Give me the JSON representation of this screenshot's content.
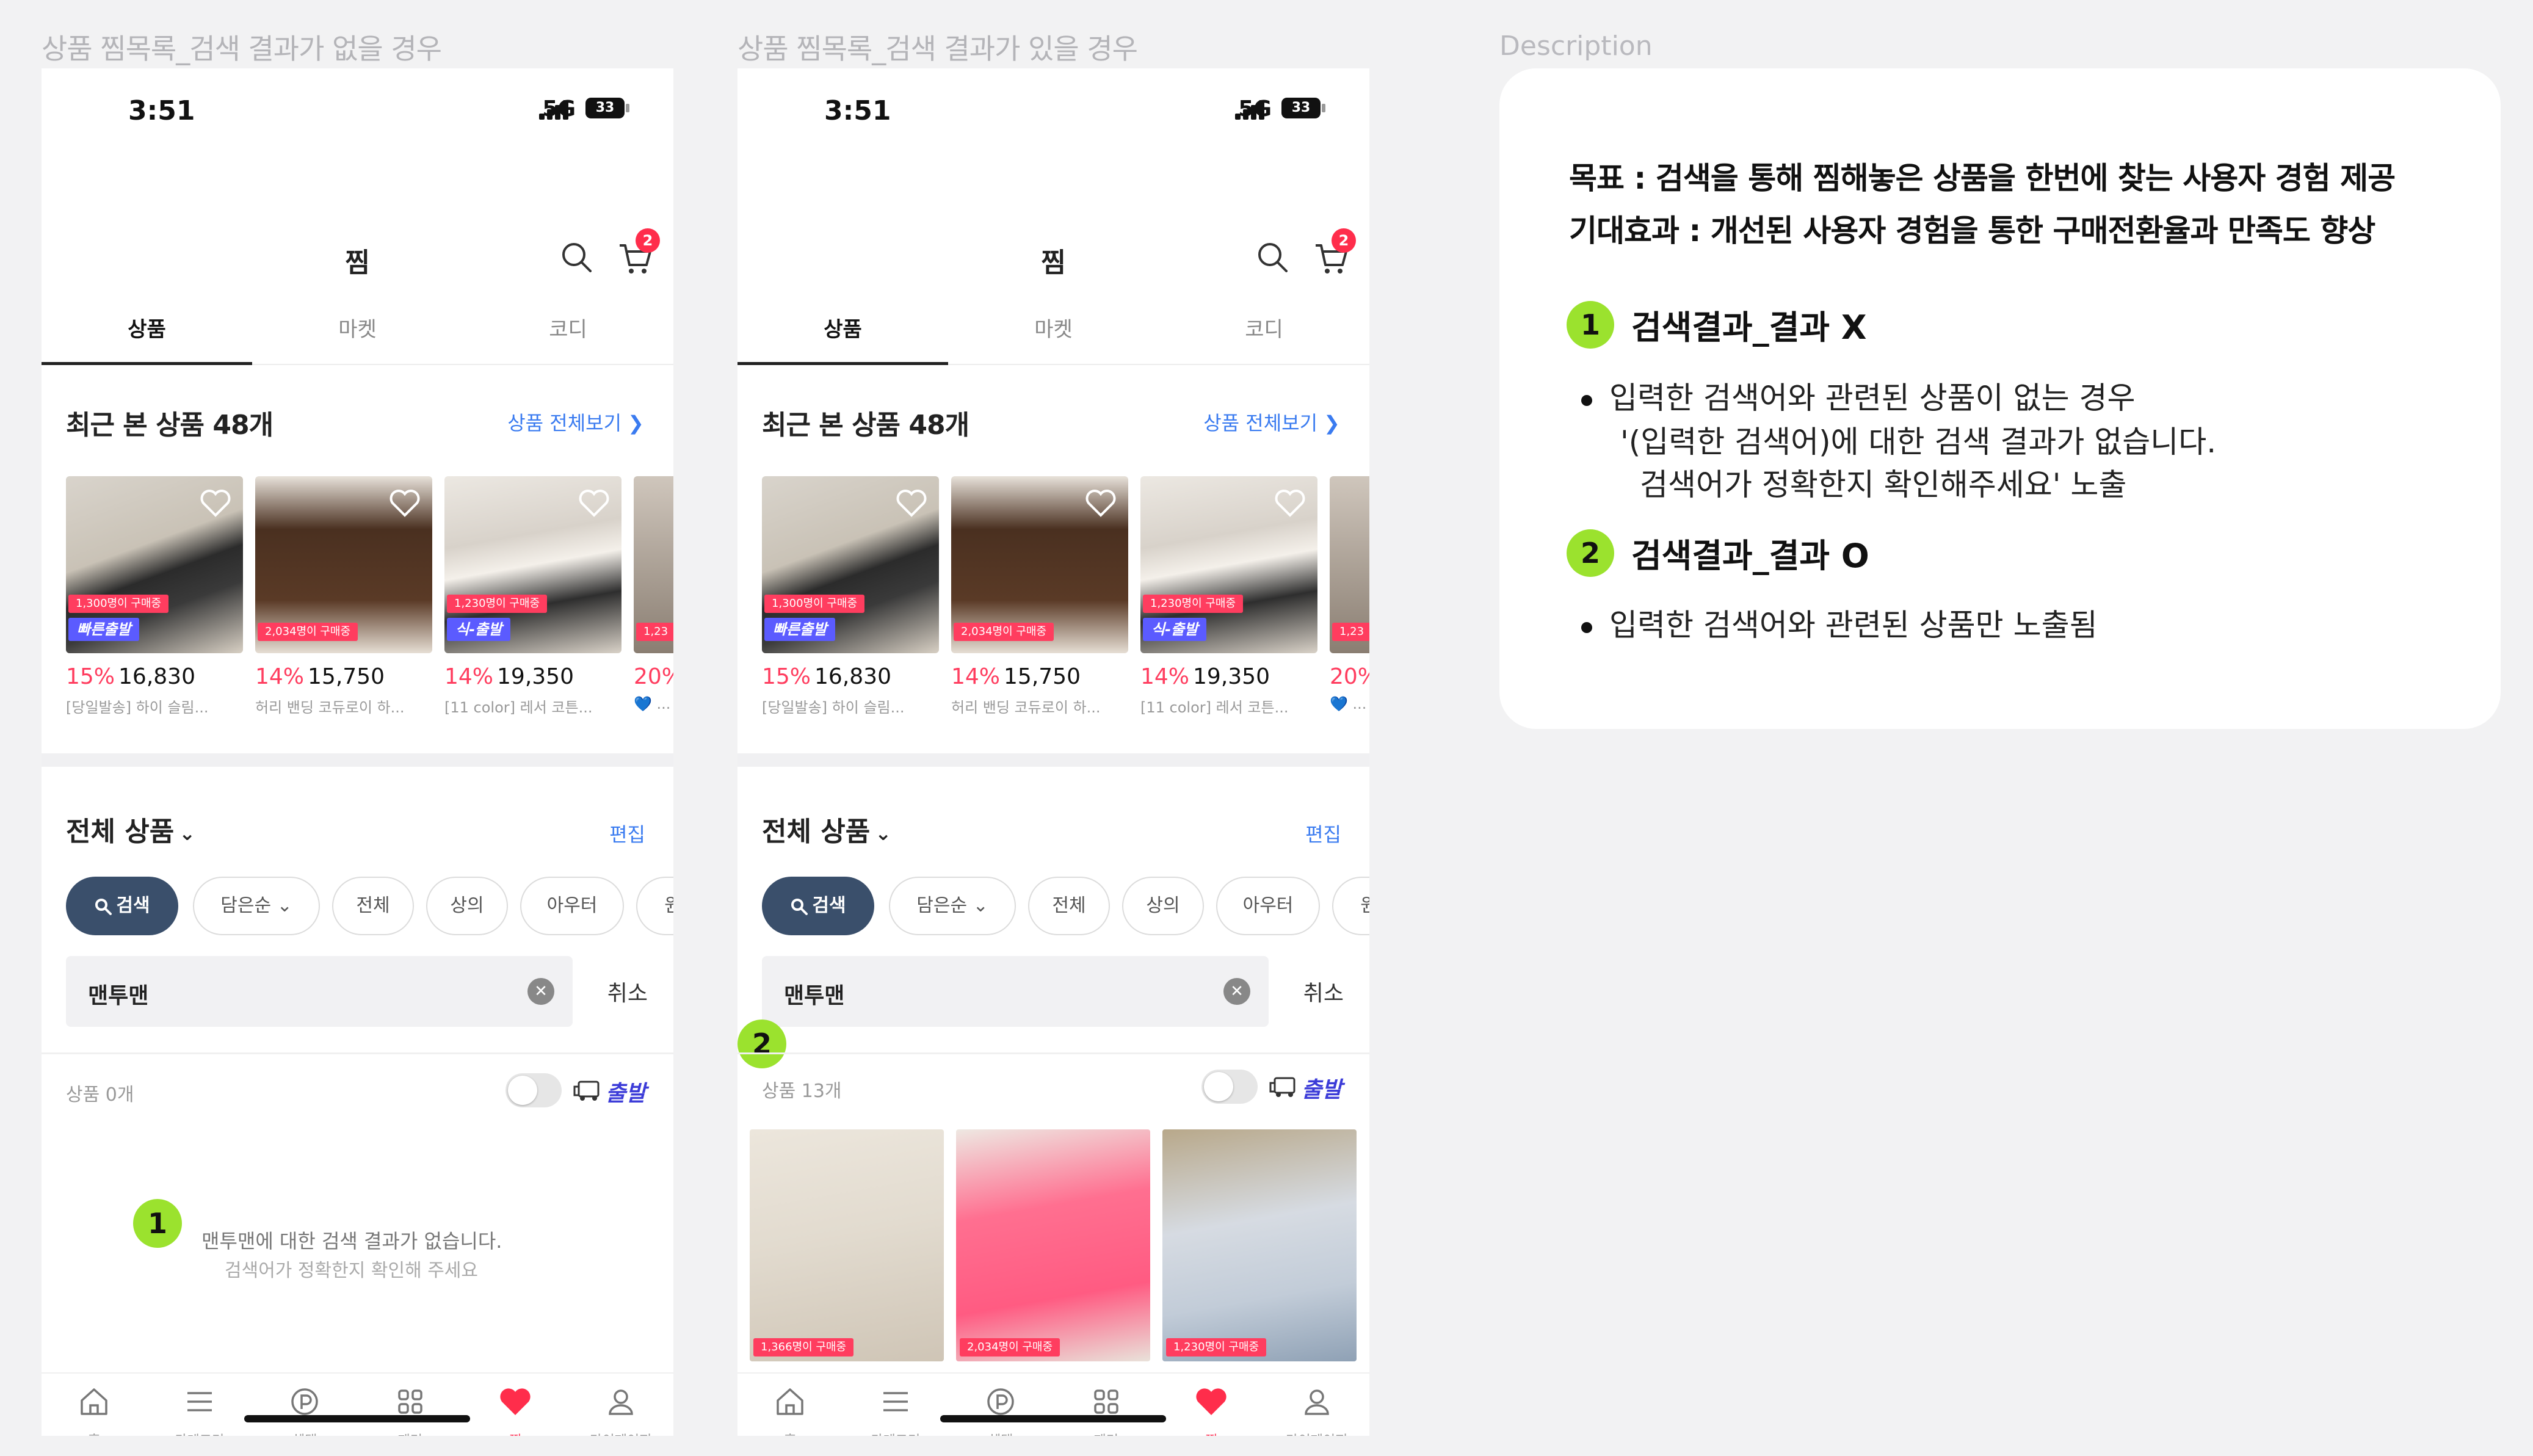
{
  "captions": {
    "left": "상품 찜목록_검색 결과가 없을 경우",
    "middle": "상품 찜목록_검색 결과가 있을 경우",
    "description": "Description"
  },
  "status": {
    "time": "3:51",
    "network": "5G",
    "battery": "33"
  },
  "header": {
    "title": "찜",
    "cart_count": "2"
  },
  "tabs": [
    "상품",
    "마켓",
    "코디"
  ],
  "recent": {
    "title": "최근 본 상품 48개",
    "view_all": "상품 전체보기 ❯",
    "items": [
      {
        "discount": "15%",
        "price": "16,830",
        "name": "[당일발송] 하이 슬림...",
        "tag1": "1,300명이 구매중",
        "tag2": "빠른출발"
      },
      {
        "discount": "14%",
        "price": "15,750",
        "name": "허리 밴딩 코듀로이 하...",
        "tag1": "2,034명이 구매중",
        "tag2": ""
      },
      {
        "discount": "14%",
        "price": "19,350",
        "name": "[11 color] 레서 코튼...",
        "tag1": "1,230명이 구매중",
        "tag2": "식-출발"
      },
      {
        "discount": "20%",
        "price": "",
        "name": "💙 ...",
        "tag1": "1,23",
        "tag2": ""
      }
    ]
  },
  "all_products": {
    "title": "전체 상품",
    "edit": "편집"
  },
  "chips": {
    "search": "검색",
    "sort": "담은순",
    "all": "전체",
    "top": "상의",
    "outer": "아우터",
    "more": "원"
  },
  "search": {
    "value": "맨투맨",
    "cancel": "취소"
  },
  "delivery_label": "출발",
  "left_screen": {
    "count": "상품 0개",
    "badge": "1",
    "empty_message": "맨투맨에 대한 검색 결과가 없습니다.",
    "empty_sub": "검색어가 정확한지 확인해 주세요"
  },
  "right_screen": {
    "count": "상품 13개",
    "badge": "2",
    "products": [
      {
        "tag": "1,366명이 구매중"
      },
      {
        "tag": "2,034명이 구매중"
      },
      {
        "tag": "1,230명이 구매중"
      }
    ]
  },
  "bottom_nav": [
    "홈",
    "카테고리",
    "혜택",
    "제미",
    "찜",
    "마이페이지"
  ],
  "description": {
    "goal": "목표 : 검색을 통해 찜해놓은 상품을 한번에 찾는 사용자 경험 제공",
    "effect": "기대효과 : 개선된 사용자 경험을 통한 구매전환율과 만족도 향상",
    "section1": {
      "num": "1",
      "title": "검색결과_결과 X",
      "line1": "입력한 검색어와 관련된 상품이 없는 경우",
      "line2": "'(입력한 검색어)에 대한 검색 결과가 없습니다.",
      "line3": "검색어가 정확한지 확인해주세요' 노출"
    },
    "section2": {
      "num": "2",
      "title": "검색결과_결과 O",
      "line1": "입력한 검색어와 관련된 상품만 노출됨"
    }
  },
  "colors": {
    "accent_blue": "#3a7bf0",
    "badge_green": "#9be22e",
    "discount_red": "#ff3d5f",
    "chip_primary": "#3a4f6b"
  }
}
